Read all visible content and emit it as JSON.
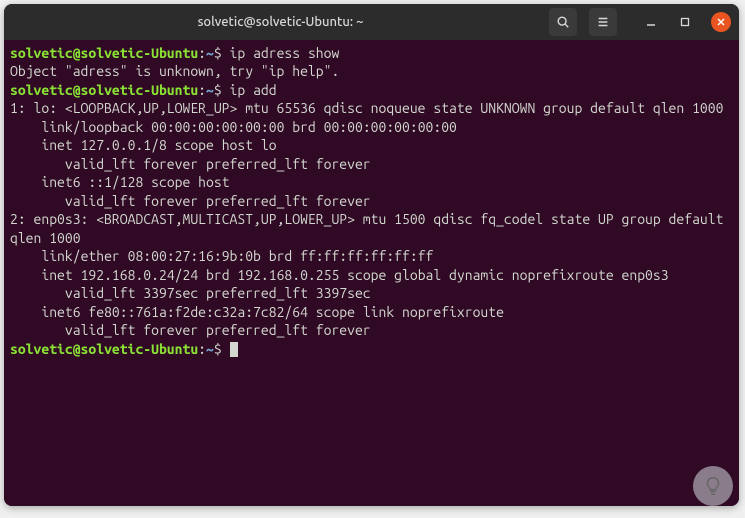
{
  "window": {
    "title": "solvetic@solvetic-Ubuntu: ~"
  },
  "prompt": {
    "user_host": "solvetic@solvetic-Ubuntu",
    "colon": ":",
    "path": "~",
    "dollar": "$"
  },
  "terminal": {
    "cmd1": "ip adress show",
    "out1": "Object \"adress\" is unknown, try \"ip help\".",
    "cmd2": "ip add",
    "out2_l1": "1: lo: <LOOPBACK,UP,LOWER_UP> mtu 65536 qdisc noqueue state UNKNOWN group default qlen 1000",
    "out2_l2": "    link/loopback 00:00:00:00:00:00 brd 00:00:00:00:00:00",
    "out2_l3": "    inet 127.0.0.1/8 scope host lo",
    "out2_l4": "       valid_lft forever preferred_lft forever",
    "out2_l5": "    inet6 ::1/128 scope host",
    "out2_l6": "       valid_lft forever preferred_lft forever",
    "out2_l7": "2: enp0s3: <BROADCAST,MULTICAST,UP,LOWER_UP> mtu 1500 qdisc fq_codel state UP group default qlen 1000",
    "out2_l8": "    link/ether 08:00:27:16:9b:0b brd ff:ff:ff:ff:ff:ff",
    "out2_l9": "    inet 192.168.0.24/24 brd 192.168.0.255 scope global dynamic noprefixroute enp0s3",
    "out2_l10": "       valid_lft 3397sec preferred_lft 3397sec",
    "out2_l11": "    inet6 fe80::761a:f2de:c32a:7c82/64 scope link noprefixroute",
    "out2_l12": "       valid_lft forever preferred_lft forever"
  }
}
